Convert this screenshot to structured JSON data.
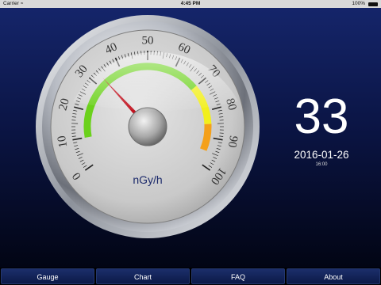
{
  "status_bar": {
    "carrier": "Carrier",
    "wifi_icon": "wifi-icon",
    "time": "4:45 PM",
    "battery_percent": "100%",
    "battery_icon": "battery-icon"
  },
  "gauge": {
    "unit": "nGy/h",
    "ticks": [
      "0",
      "10",
      "20",
      "30",
      "40",
      "50",
      "60",
      "70",
      "80",
      "90",
      "100"
    ],
    "min": 0,
    "max": 100,
    "value": 33,
    "zones": [
      {
        "from": 10,
        "to": 70,
        "color": "#6bd11c"
      },
      {
        "from": 70,
        "to": 85,
        "color": "#f2ef1c"
      },
      {
        "from": 85,
        "to": 95,
        "color": "#f4a01a"
      }
    ],
    "needle_color": "#c1121f"
  },
  "reading": {
    "value": "33",
    "date": "2016-01-26",
    "time": "16:00"
  },
  "tabs": [
    {
      "label": "Gauge"
    },
    {
      "label": "Chart"
    },
    {
      "label": "FAQ"
    },
    {
      "label": "About"
    }
  ]
}
